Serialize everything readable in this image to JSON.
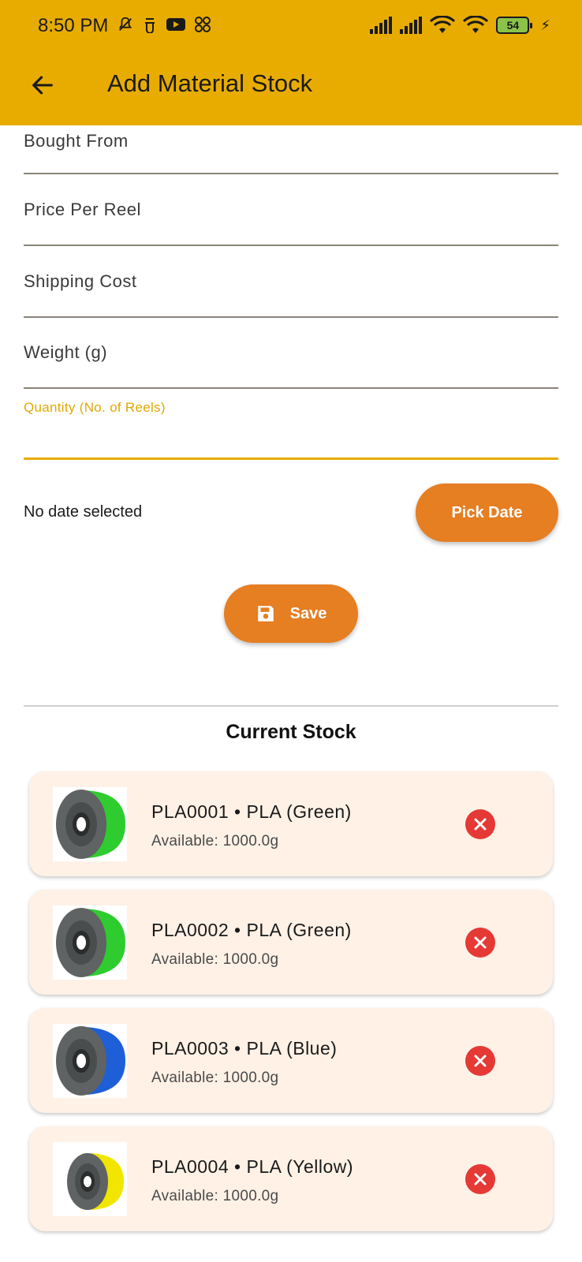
{
  "status_bar": {
    "time": "8:50 PM",
    "battery_level": "54",
    "left_icons": [
      "bell-off-icon",
      "app-icon",
      "youtube-icon",
      "apps-icon"
    ],
    "right_icons": [
      "signal-icon",
      "signal-icon",
      "wifi-icon",
      "wifi-icon",
      "battery-icon",
      "charging-icon"
    ]
  },
  "app_bar": {
    "title": "Add Material Stock",
    "back_icon": "arrow-left-icon"
  },
  "form": {
    "bought_from_label": "Bought From",
    "price_per_reel_label": "Price Per Reel",
    "shipping_cost_label": "Shipping Cost",
    "weight_label": "Weight (g)",
    "quantity_label": "Quantity (No. of Reels)",
    "quantity_value": "",
    "date_text": "No date selected",
    "pick_date_label": "Pick Date",
    "save_label": "Save",
    "accent_color": "#E8AC00",
    "button_color": "#E67E22"
  },
  "current_stock": {
    "title": "Current Stock",
    "items": [
      {
        "title": "PLA0001 • PLA (Green)",
        "available": "Available: 1000.0g",
        "color": "#2ECC2E"
      },
      {
        "title": "PLA0002 • PLA (Green)",
        "available": "Available: 1000.0g",
        "color": "#2ECC2E"
      },
      {
        "title": "PLA0003 • PLA (Blue)",
        "available": "Available: 1000.0g",
        "color": "#1E5FD8"
      },
      {
        "title": "PLA0004 • PLA (Yellow)",
        "available": "Available: 1000.0g",
        "color": "#F2E600"
      }
    ]
  }
}
